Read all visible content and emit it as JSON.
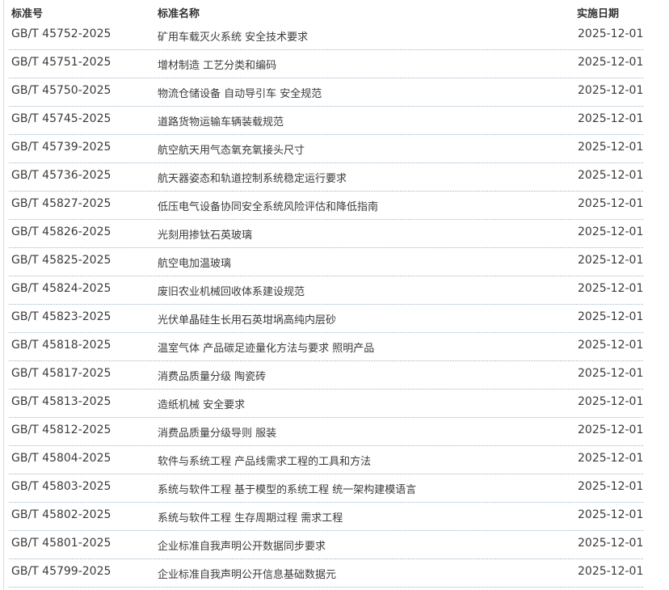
{
  "table": {
    "headers": {
      "number": "标准号",
      "name": "标准名称",
      "date": "实施日期"
    },
    "rows": [
      {
        "number": "GB/T 45752-2025",
        "name": "矿用车载灭火系统 安全技术要求",
        "date": "2025-12-01"
      },
      {
        "number": "GB/T 45751-2025",
        "name": "增材制造 工艺分类和编码",
        "date": "2025-12-01"
      },
      {
        "number": "GB/T 45750-2025",
        "name": "物流仓储设备 自动导引车 安全规范",
        "date": "2025-12-01"
      },
      {
        "number": "GB/T 45745-2025",
        "name": "道路货物运输车辆装载规范",
        "date": "2025-12-01"
      },
      {
        "number": "GB/T 45739-2025",
        "name": "航空航天用气态氧充氧接头尺寸",
        "date": "2025-12-01"
      },
      {
        "number": "GB/T 45736-2025",
        "name": "航天器姿态和轨道控制系统稳定运行要求",
        "date": "2025-12-01"
      },
      {
        "number": "GB/T 45827-2025",
        "name": "低压电气设备协同安全系统风险评估和降低指南",
        "date": "2025-12-01"
      },
      {
        "number": "GB/T 45826-2025",
        "name": "光刻用掺钛石英玻璃",
        "date": "2025-12-01"
      },
      {
        "number": "GB/T 45825-2025",
        "name": "航空电加温玻璃",
        "date": "2025-12-01"
      },
      {
        "number": "GB/T 45824-2025",
        "name": "废旧农业机械回收体系建设规范",
        "date": "2025-12-01"
      },
      {
        "number": "GB/T 45823-2025",
        "name": "光伏单晶硅生长用石英坩埚高纯内层砂",
        "date": "2025-12-01"
      },
      {
        "number": "GB/T 45818-2025",
        "name": "温室气体 产品碳足迹量化方法与要求 照明产品",
        "date": "2025-12-01"
      },
      {
        "number": "GB/T 45817-2025",
        "name": "消费品质量分级 陶瓷砖",
        "date": "2025-12-01"
      },
      {
        "number": "GB/T 45813-2025",
        "name": "造纸机械 安全要求",
        "date": "2025-12-01"
      },
      {
        "number": "GB/T 45812-2025",
        "name": "消费品质量分级导则 服装",
        "date": "2025-12-01"
      },
      {
        "number": "GB/T 45804-2025",
        "name": "软件与系统工程 产品线需求工程的工具和方法",
        "date": "2025-12-01"
      },
      {
        "number": "GB/T 45803-2025",
        "name": "系统与软件工程 基于模型的系统工程 统一架构建模语言",
        "date": "2025-12-01"
      },
      {
        "number": "GB/T 45802-2025",
        "name": "系统与软件工程 生存周期过程 需求工程",
        "date": "2025-12-01"
      },
      {
        "number": "GB/T 45801-2025",
        "name": "企业标准自我声明公开数据同步要求",
        "date": "2025-12-01"
      },
      {
        "number": "GB/T 45799-2025",
        "name": "企业标准自我声明公开信息基础数据元",
        "date": "2025-12-01"
      }
    ]
  }
}
